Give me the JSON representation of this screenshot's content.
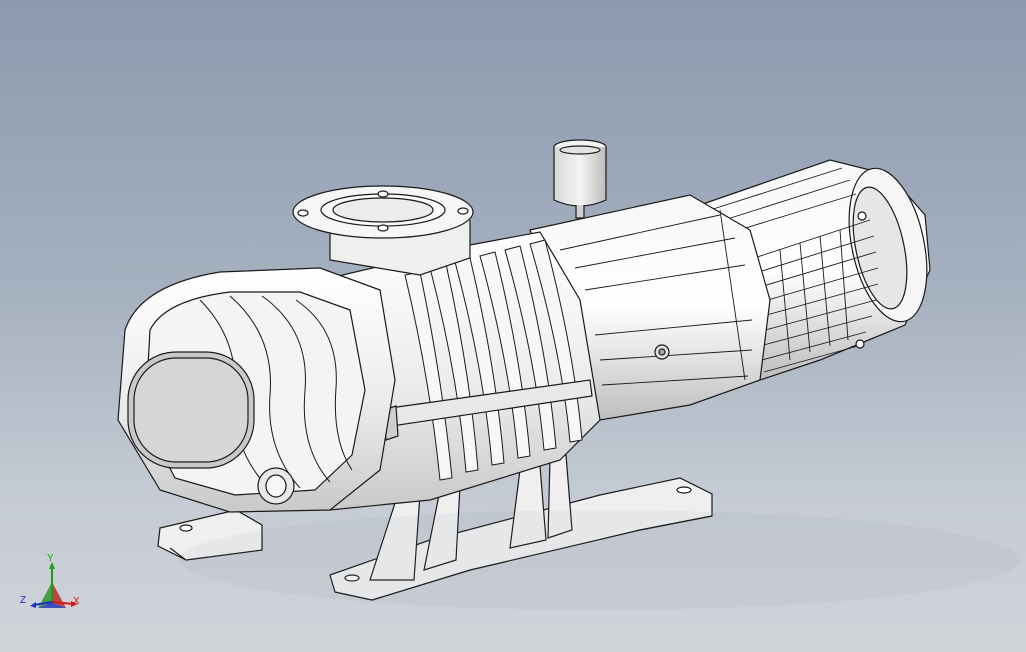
{
  "viewport": {
    "background_top": "#8c9aae",
    "background_bottom": "#d1d4d9",
    "model_fill": "#f2f2f2",
    "model_edge": "#1a1a1a"
  },
  "model": {
    "description_icon": "roots-vacuum-pump-with-motor-icon"
  },
  "triad": {
    "x_label": "X",
    "y_label": "Y",
    "z_label": "Z",
    "x_color": "#d01b1b",
    "y_color": "#19a019",
    "z_color": "#1c2fc4"
  }
}
